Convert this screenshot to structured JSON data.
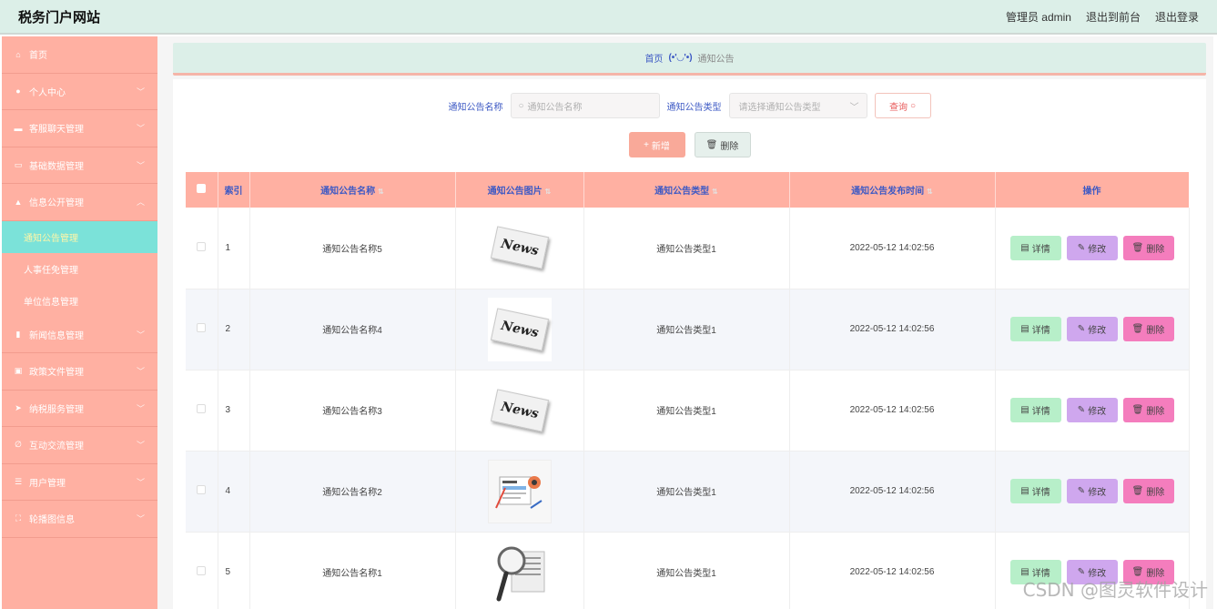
{
  "header": {
    "title": "税务门户网站",
    "links": [
      "管理员 admin",
      "退出到前台",
      "退出登录"
    ]
  },
  "sidebar": {
    "items": [
      {
        "label": "首页",
        "icon": "home-icon",
        "has_chevron": false
      },
      {
        "label": "个人中心",
        "icon": "user-icon",
        "has_chevron": true
      },
      {
        "label": "客服聊天管理",
        "icon": "briefcase-icon",
        "has_chevron": true
      },
      {
        "label": "基础数据管理",
        "icon": "chat-icon",
        "has_chevron": true
      },
      {
        "label": "信息公开管理",
        "icon": "thumb-icon",
        "has_chevron": true,
        "expanded": true,
        "children": [
          {
            "label": "通知公告管理",
            "active": true
          },
          {
            "label": "人事任免管理",
            "active": false
          },
          {
            "label": "单位信息管理",
            "active": false
          }
        ]
      },
      {
        "label": "新闻信息管理",
        "icon": "bar-chart-icon",
        "has_chevron": true
      },
      {
        "label": "政策文件管理",
        "icon": "clipboard-icon",
        "has_chevron": true
      },
      {
        "label": "纳税服务管理",
        "icon": "send-icon",
        "has_chevron": true
      },
      {
        "label": "互动交流管理",
        "icon": "pulse-icon",
        "has_chevron": true
      },
      {
        "label": "用户管理",
        "icon": "sliders-icon",
        "has_chevron": true
      },
      {
        "label": "轮播图信息",
        "icon": "fullscreen-icon",
        "has_chevron": true
      }
    ]
  },
  "breadcrumb": {
    "home": "首页",
    "separator": "(•'◡'•)",
    "current": "通知公告"
  },
  "search": {
    "name_label": "通知公告名称",
    "name_placeholder": "通知公告名称",
    "type_label": "通知公告类型",
    "type_placeholder": "请选择通知公告类型",
    "query_label": "查询"
  },
  "actions": {
    "add_label": "新增",
    "delete_label": "删除"
  },
  "table": {
    "columns": [
      "索引",
      "通知公告名称",
      "通知公告图片",
      "通知公告类型",
      "通知公告发布时间",
      "操作"
    ],
    "rows": [
      {
        "index": "1",
        "name": "通知公告名称5",
        "image": "news-paper",
        "type": "通知公告类型1",
        "time": "2022-05-12 14:02:56"
      },
      {
        "index": "2",
        "name": "通知公告名称4",
        "image": "news-paper-boxed",
        "type": "通知公告类型1",
        "time": "2022-05-12 14:02:56"
      },
      {
        "index": "3",
        "name": "通知公告名称3",
        "image": "news-paper",
        "type": "通知公告类型1",
        "time": "2022-05-12 14:02:56"
      },
      {
        "index": "4",
        "name": "通知公告名称2",
        "image": "news-illustration",
        "type": "通知公告类型1",
        "time": "2022-05-12 14:02:56"
      },
      {
        "index": "5",
        "name": "通知公告名称1",
        "image": "news-magnifier",
        "type": "通知公告类型1",
        "time": "2022-05-12 14:02:56"
      }
    ],
    "row_actions": {
      "detail": "详情",
      "edit": "修改",
      "delete": "删除"
    }
  },
  "image_text": "News",
  "watermark": "CSDN @图灵软件设计",
  "colors": {
    "sidebar_bg": "#ffb0a2",
    "header_bg": "#dcefe8",
    "active_item_bg": "#7be2d9",
    "table_header_bg": "#ffb0a2",
    "detail_btn": "#b7efc9",
    "edit_btn": "#cfa7ee",
    "delete_btn": "#f47dbd"
  }
}
